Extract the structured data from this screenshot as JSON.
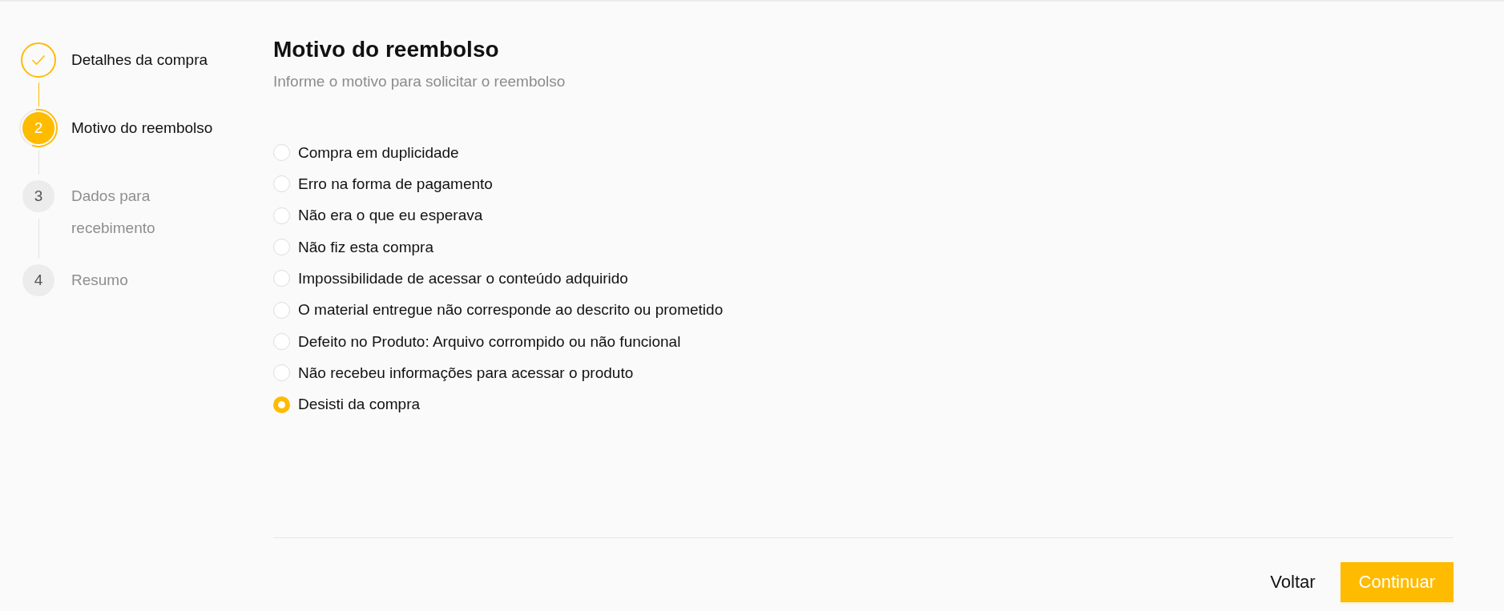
{
  "stepper": {
    "steps": [
      {
        "label": "Detalhes da compra",
        "completed": true,
        "selected": false
      },
      {
        "number": "2",
        "label": "Motivo do reembolso",
        "completed": false,
        "selected": true
      },
      {
        "number": "3",
        "label": "Dados para recebimento",
        "completed": false,
        "selected": false
      },
      {
        "number": "4",
        "label": "Resumo",
        "completed": false,
        "selected": false
      }
    ]
  },
  "form": {
    "title": "Motivo do reembolso",
    "subtitle": "Informe o motivo para solicitar o reembolso",
    "options": [
      {
        "label": "Compra em duplicidade",
        "selected": false
      },
      {
        "label": "Erro na forma de pagamento",
        "selected": false
      },
      {
        "label": "Não era o que eu esperava",
        "selected": false
      },
      {
        "label": "Não fiz esta compra",
        "selected": false
      },
      {
        "label": "Impossibilidade de acessar o conteúdo adquirido",
        "selected": false
      },
      {
        "label": "O material entregue não corresponde ao descrito ou prometido",
        "selected": false
      },
      {
        "label": "Defeito no Produto: Arquivo corrompido ou não funcional",
        "selected": false
      },
      {
        "label": "Não recebeu informações para acessar o produto",
        "selected": false
      },
      {
        "label": "Desisti da compra",
        "selected": true
      }
    ]
  },
  "footer": {
    "buttons": [
      {
        "label": "Voltar",
        "kind": "text"
      },
      {
        "label": "Continuar",
        "kind": "primary"
      }
    ]
  }
}
